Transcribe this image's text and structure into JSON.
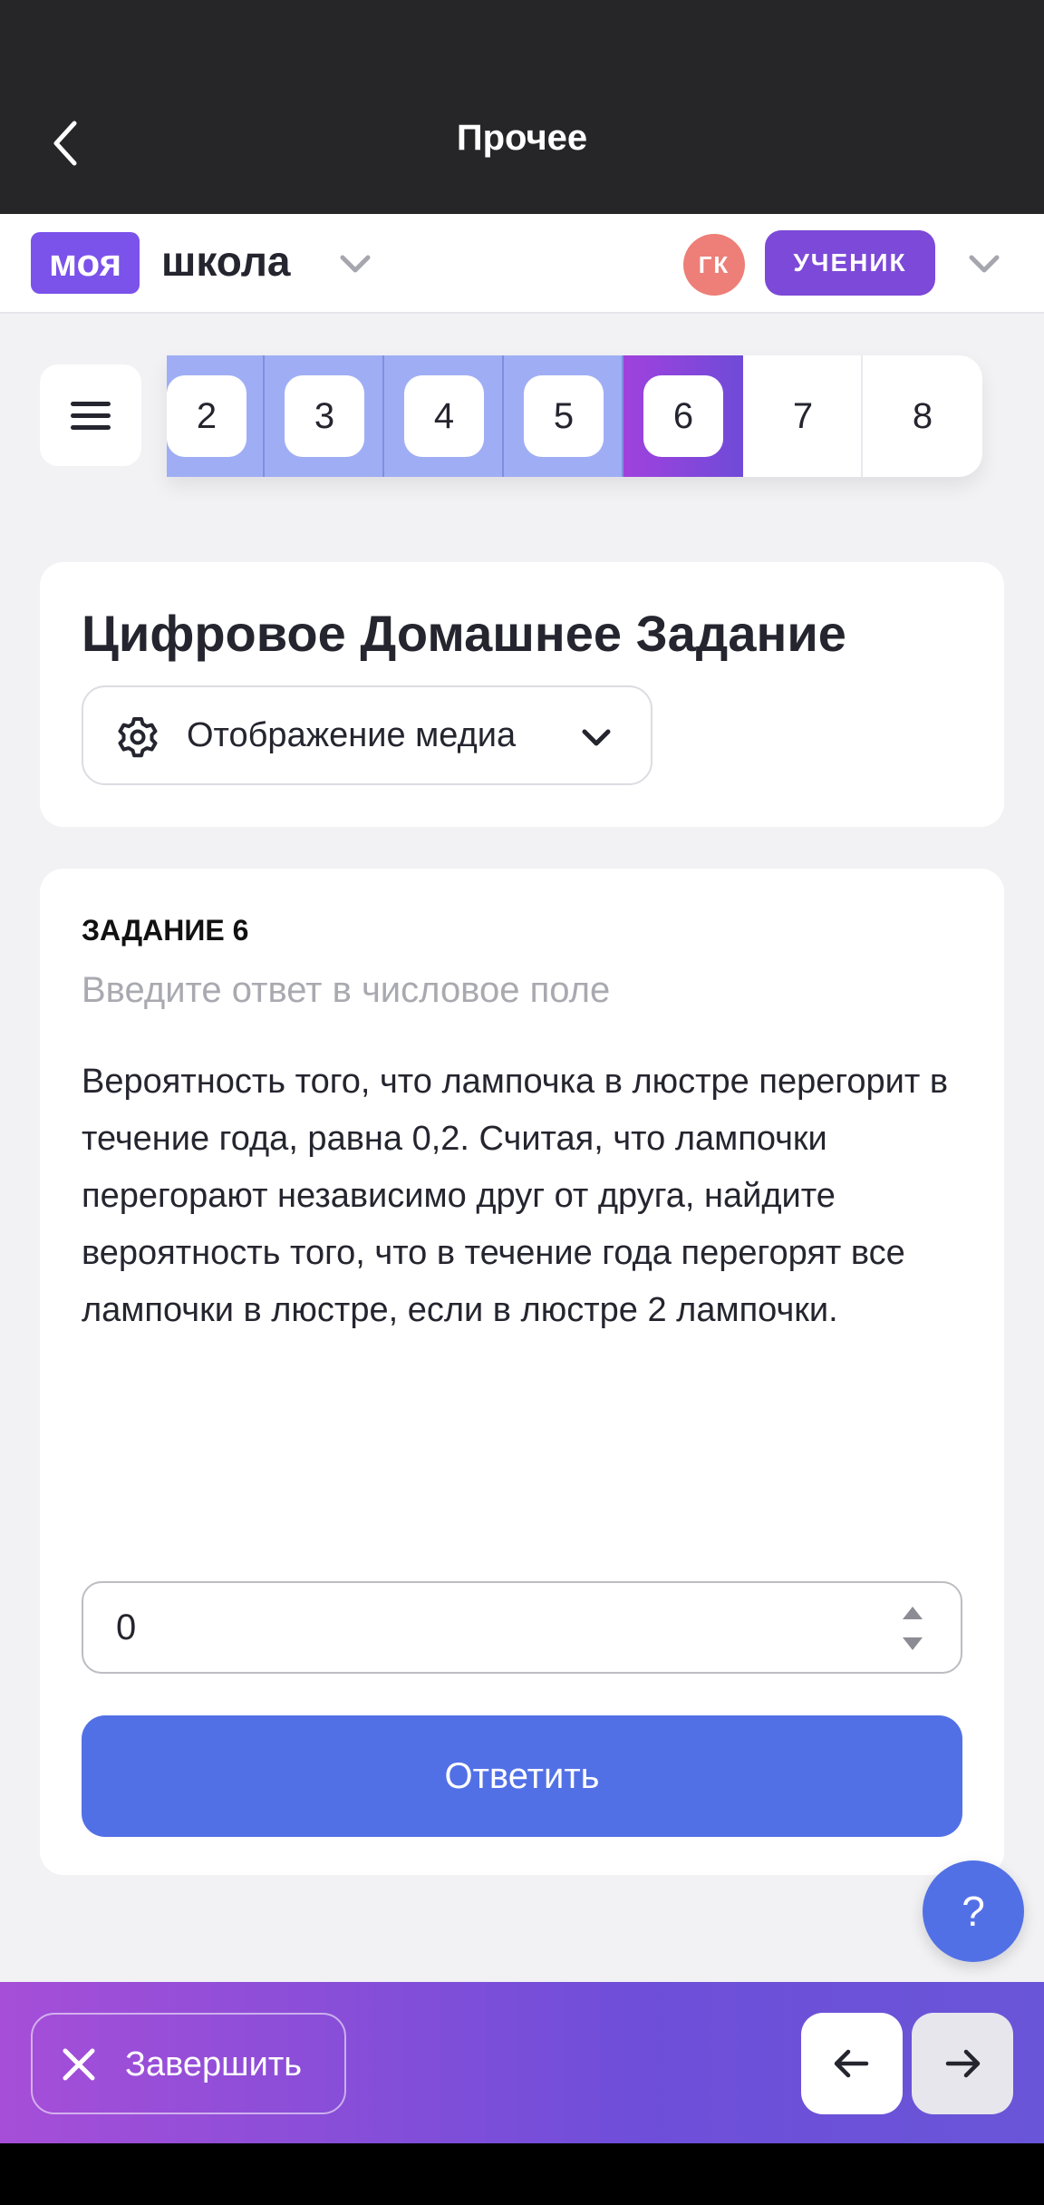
{
  "app_bar": {
    "title": "Прочее"
  },
  "brand": {
    "logo_part1": "моя",
    "logo_part2": "школа",
    "avatar_initials": "ГК",
    "role": "УЧЕНИК"
  },
  "tasks": {
    "items": [
      {
        "label": "2",
        "state": "done"
      },
      {
        "label": "3",
        "state": "done"
      },
      {
        "label": "4",
        "state": "done"
      },
      {
        "label": "5",
        "state": "done"
      },
      {
        "label": "6",
        "state": "active"
      },
      {
        "label": "7",
        "state": "todo"
      },
      {
        "label": "8",
        "state": "todo"
      }
    ]
  },
  "header_card": {
    "title": "Цифровое Домашнее Задание",
    "media_select": "Отображение медиа"
  },
  "task_card": {
    "label": "ЗАДАНИЕ 6",
    "hint": "Введите ответ в числовое поле",
    "question": "Вероятность того, что лампочка в люстре перегорит в течение года, равна 0,2. Считая, что лампочки перегорают независимо друг от друга, найдите вероятность того, что в течение года перегорят все лампочки в люстре, если в люстре 2 лампочки.",
    "answer_value": "0",
    "submit_label": "Ответить"
  },
  "help_label": "?",
  "bottom_bar": {
    "finish_label": "Завершить"
  },
  "colors": {
    "accent": "#5270e6",
    "brand": "#7b52ea",
    "done_task": "#9faef4",
    "avatar": "#ed7f78"
  }
}
